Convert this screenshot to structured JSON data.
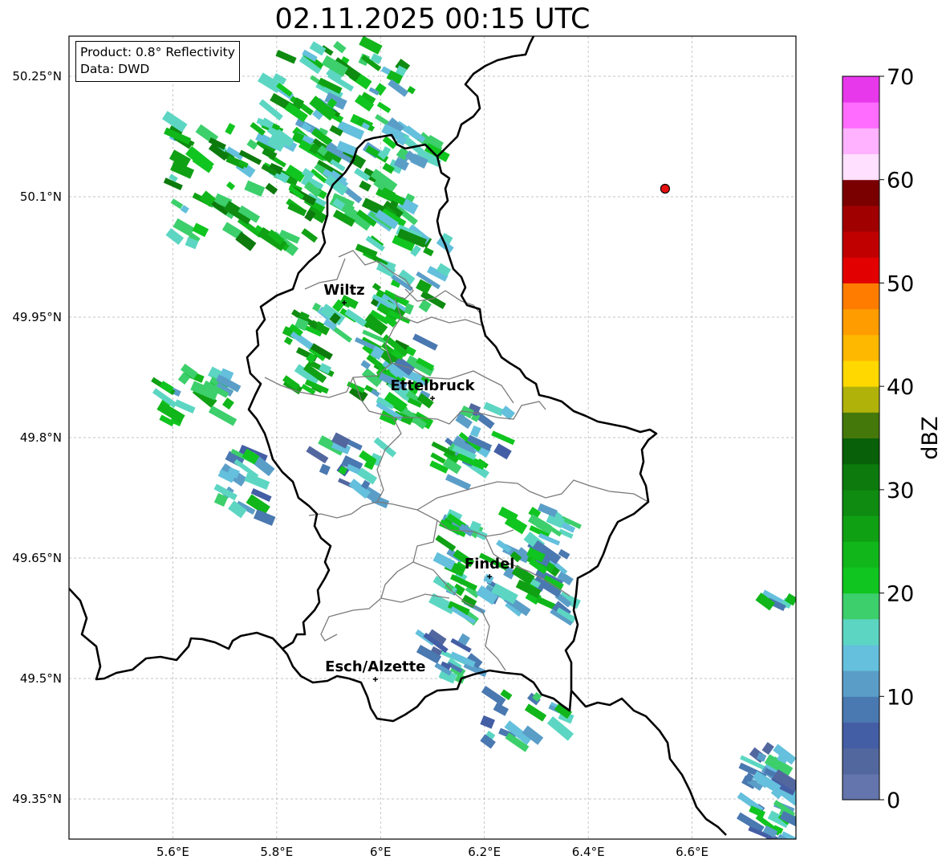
{
  "title": "02.11.2025 00:15 UTC",
  "info": {
    "product": "Product: 0.8° Reflectivity",
    "data": "Data: DWD"
  },
  "axes": {
    "lon_range": [
      5.4,
      6.8
    ],
    "lat_range": [
      49.3,
      50.3
    ],
    "lon_ticks": [
      {
        "value": 5.6,
        "label": "5.6°E"
      },
      {
        "value": 5.8,
        "label": "5.8°E"
      },
      {
        "value": 6.0,
        "label": "6°E"
      },
      {
        "value": 6.2,
        "label": "6.2°E"
      },
      {
        "value": 6.4,
        "label": "6.4°E"
      },
      {
        "value": 6.6,
        "label": "6.6°E"
      }
    ],
    "lat_ticks": [
      {
        "value": 50.25,
        "label": "50.25°N"
      },
      {
        "value": 50.1,
        "label": "50.1°N"
      },
      {
        "value": 49.95,
        "label": "49.95°N"
      },
      {
        "value": 49.8,
        "label": "49.8°N"
      },
      {
        "value": 49.65,
        "label": "49.65°N"
      },
      {
        "value": 49.5,
        "label": "49.5°N"
      },
      {
        "value": 49.35,
        "label": "49.35°N"
      }
    ]
  },
  "cities": [
    {
      "name": "Wiltz",
      "lon": 5.93,
      "lat": 49.968
    },
    {
      "name": "Ettelbruck",
      "lon": 6.1,
      "lat": 49.849
    },
    {
      "name": "Findel",
      "lon": 6.21,
      "lat": 49.627
    },
    {
      "name": "Esch/Alzette",
      "lon": 5.99,
      "lat": 49.499
    }
  ],
  "marker": {
    "lon": 6.548,
    "lat": 50.11,
    "color": "#e8100f"
  },
  "colorbar": {
    "label": "dBZ",
    "min": 0,
    "max": 70,
    "step": 2.5,
    "tick_labels": [
      "0",
      "10",
      "20",
      "30",
      "40",
      "50",
      "60",
      "70"
    ],
    "colors": [
      "#6474ac",
      "#53679f",
      "#445ea5",
      "#4a78b0",
      "#5a9ec8",
      "#64c0dc",
      "#5cd6c2",
      "#3ccf6b",
      "#10c51f",
      "#10b61a",
      "#10a014",
      "#0e8b10",
      "#0c7a0c",
      "#086008",
      "#44780a",
      "#b0b20a",
      "#ffd800",
      "#ffb800",
      "#ff9c00",
      "#ff7c00",
      "#e20000",
      "#c00000",
      "#a00000",
      "#7a0000",
      "#ffe0ff",
      "#ffb2ff",
      "#ff6cff",
      "#e838ec"
    ]
  },
  "radar_clusters": [
    {
      "lon": 5.92,
      "lat": 50.22,
      "dlon": 0.14,
      "dlat": 0.07,
      "n": 70,
      "level": 9
    },
    {
      "lon": 5.75,
      "lat": 50.12,
      "dlon": 0.15,
      "dlat": 0.08,
      "n": 90,
      "level": 10
    },
    {
      "lon": 5.98,
      "lat": 50.12,
      "dlon": 0.08,
      "dlat": 0.05,
      "n": 45,
      "level": 9
    },
    {
      "lon": 6.08,
      "lat": 50.16,
      "dlon": 0.04,
      "dlat": 0.02,
      "n": 12,
      "level": 8
    },
    {
      "lon": 6.05,
      "lat": 50.01,
      "dlon": 0.08,
      "dlat": 0.05,
      "n": 35,
      "level": 9
    },
    {
      "lon": 5.93,
      "lat": 49.91,
      "dlon": 0.11,
      "dlat": 0.06,
      "n": 60,
      "level": 10
    },
    {
      "lon": 6.03,
      "lat": 49.87,
      "dlon": 0.06,
      "dlat": 0.05,
      "n": 35,
      "level": 8
    },
    {
      "lon": 5.64,
      "lat": 49.85,
      "dlon": 0.07,
      "dlat": 0.035,
      "n": 25,
      "level": 9
    },
    {
      "lon": 5.72,
      "lat": 49.74,
      "dlon": 0.06,
      "dlat": 0.04,
      "n": 18,
      "level": 7
    },
    {
      "lon": 5.94,
      "lat": 49.76,
      "dlon": 0.07,
      "dlat": 0.04,
      "n": 20,
      "level": 6
    },
    {
      "lon": 6.14,
      "lat": 49.77,
      "dlon": 0.06,
      "dlat": 0.03,
      "n": 16,
      "level": 8
    },
    {
      "lon": 6.2,
      "lat": 49.81,
      "dlon": 0.05,
      "dlat": 0.03,
      "n": 15,
      "level": 6
    },
    {
      "lon": 6.24,
      "lat": 49.64,
      "dlon": 0.13,
      "dlat": 0.07,
      "n": 90,
      "level": 8
    },
    {
      "lon": 6.14,
      "lat": 49.53,
      "dlon": 0.06,
      "dlat": 0.03,
      "n": 18,
      "level": 6
    },
    {
      "lon": 6.28,
      "lat": 49.45,
      "dlon": 0.08,
      "dlat": 0.03,
      "n": 18,
      "level": 7
    },
    {
      "lon": 6.75,
      "lat": 49.35,
      "dlon": 0.04,
      "dlat": 0.07,
      "n": 45,
      "level": 6
    },
    {
      "lon": 6.77,
      "lat": 49.6,
      "dlon": 0.03,
      "dlat": 0.01,
      "n": 5,
      "level": 7
    }
  ]
}
